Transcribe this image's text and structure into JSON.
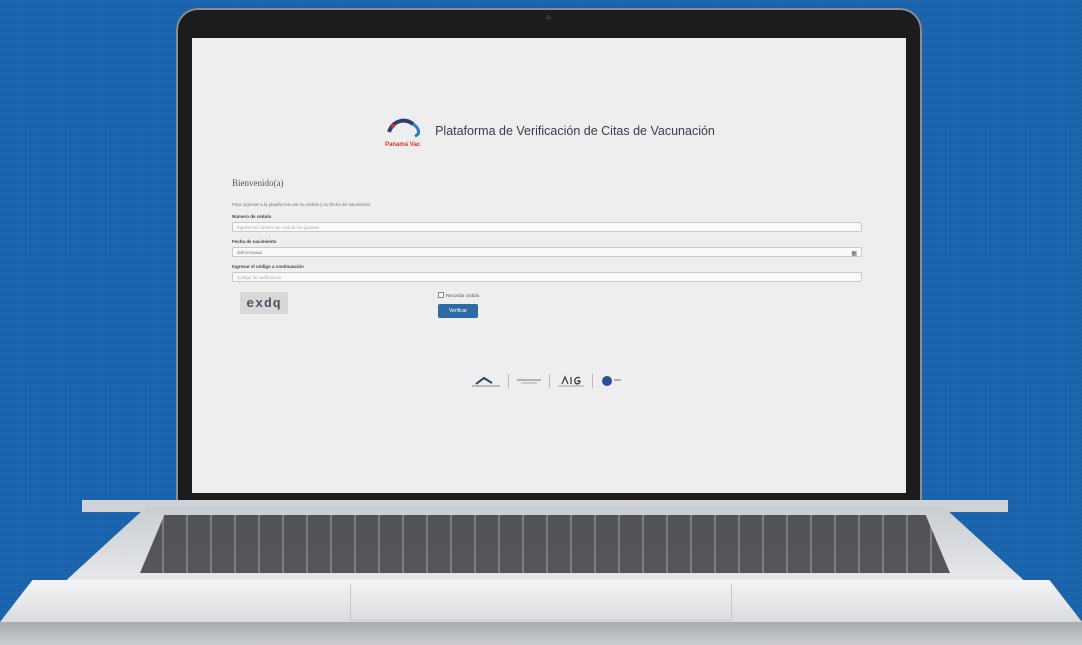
{
  "platform": {
    "title": "Plataforma de Verificación de Citas de Vacunación",
    "logo_text_a": "Panamá",
    "logo_text_b": "Vac"
  },
  "form": {
    "heading": "Bienvenido(a)",
    "intro": "Para ingresar a la plataforma use su cédula y su fecha de nacimiento",
    "cedula_label": "Número de cédula",
    "cedula_placeholder": "Ingrese su número de cédula sin guiones",
    "dob_label": "Fecha de nacimiento",
    "dob_placeholder": "dd/mm/aaaa",
    "captcha_label": "Ingresar el código a continuación",
    "captcha_placeholder": "Código de verificación",
    "captcha_code": "exdq",
    "remember_label": "Recordar cédula",
    "submit_label": "Verificar"
  },
  "footer_logos": [
    "MINSA",
    "CSS",
    "AIG",
    "GOB"
  ],
  "colors": {
    "background": "#1a63ad",
    "button": "#2e6aa3"
  }
}
